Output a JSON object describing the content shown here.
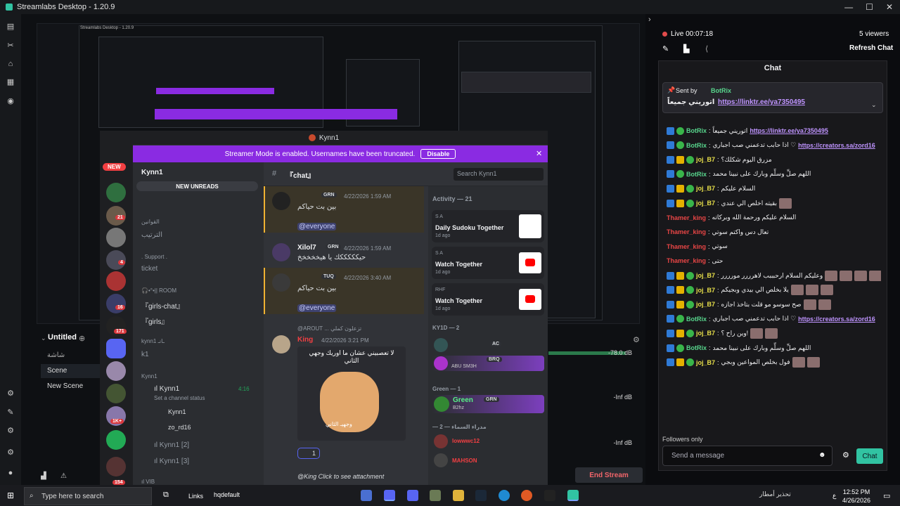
{
  "app": {
    "title": "Streamlabs Desktop - 1.20.9",
    "window_controls": [
      "—",
      "☐",
      "✕"
    ]
  },
  "nested_titles": {
    "outer": "Streamlabs Desktop - 1.20.9",
    "inner": "Kynn1"
  },
  "discord": {
    "window_title": "Kynn1",
    "banner_text": "Streamer Mode is enabled. Usernames have been truncated.",
    "banner_button": "Disable",
    "new_pill": "NEW",
    "server_name": "Kynn1",
    "channel_header": "『chat』",
    "search_placeholder": "Search Kynn1",
    "new_unreads": "NEW UNREADS",
    "server_badges": [
      "21",
      "4",
      "16",
      "171",
      "1K+",
      "154"
    ],
    "channels": {
      "cat_rules": "القوانين",
      "rules": "الترتيب",
      "support_cat": ". Support .",
      "ticket": "ticket",
      "room_cat": "🎧•°•|| ROOM",
      "girls_chat": "『girls-chat』",
      "girls": "『girls』",
      "kynn1_cat": "kynn1 ـانـ",
      "k1": "k1",
      "kynn1_voice_cat": "Kynn1",
      "voice1": "ıl Kynn1",
      "voice1_status": "Set a channel status",
      "voice1_time": "4:16",
      "voice_user1": "Kynn1",
      "voice_user1_tag": "GRN",
      "voice_user2": "zo_rd16",
      "voice2": "ıl Kynn1 [2]",
      "voice3": "ıl Kynn1 [3]",
      "vib": "ıl VIB"
    },
    "messages": [
      {
        "name": "",
        "tag": "GRN",
        "time": "4/22/2026 1:59 AM",
        "text": "بين بت حياكم",
        "mention": "@everyone"
      },
      {
        "name": "Xilol7",
        "tag": "GRN",
        "time": "4/22/2026 1:59 AM",
        "text": "حيكككككك يا هيخخخخخ"
      },
      {
        "name": "",
        "tag": "TUQ",
        "time": "4/22/2026 3:40 AM",
        "text": "بين بت حياكم",
        "mention": "@everyone"
      },
      {
        "name": "King",
        "tag": "",
        "time": "4/22/2026 3:21 PM",
        "reply": "@AROUT ... تزعلون كملي",
        "image_caption": "لا تعصبيني عشان ما اوريك وجهي الثاني",
        "image_text": "وجهيـ الثاني"
      },
      {
        "name": "",
        "time": "",
        "text": "@King Click to see attachment"
      }
    ],
    "reaction_count": "1",
    "activity": {
      "header": "Activity — 21",
      "cards": [
        {
          "who": "S A",
          "title": "Daily Sudoku Together",
          "ago": "1d ago"
        },
        {
          "who": "S A",
          "title": "Watch Together",
          "ago": "1d ago"
        },
        {
          "who": "RHF",
          "title": "Watch Together",
          "ago": "1d ago"
        }
      ]
    },
    "members": {
      "group1": "KY1D — 2",
      "m1_tag": "AC",
      "m2_name": "ABU SM3H",
      "m2_tag": "BRQ",
      "group2": "Green — 1",
      "m3_name": "Green",
      "m3_tag": "GRN",
      "m3_sub": "B2hz",
      "group3": "— مدراء السماء — 2",
      "m4_name": "lowwwc12",
      "m5_name": "MAHSON"
    }
  },
  "editor": {
    "scenes_title": "Untitled",
    "scene_collection_label": "شاشة",
    "scenes": [
      "Scene",
      "New Scene"
    ],
    "mixer": [
      "-78.0 dB",
      "-Inf dB",
      "-Inf dB"
    ],
    "end_stream": "End Stream"
  },
  "chat_panel": {
    "live_label": "Live 00:07:18",
    "viewers": "5 viewers",
    "refresh": "Refresh Chat",
    "title": "Chat",
    "pinned_by": "Sent by",
    "pinned_user": "BotRix",
    "pinned_text": "اتوريني جميعاً",
    "pinned_link": "https://linktr.ee/ya7350495",
    "lines": [
      {
        "user": "BotRix",
        "color": "g",
        "text": "اتوريني جميعاً",
        "link": "https://linktr.ee/ya7350495",
        "badges": 2
      },
      {
        "user": "BotRix",
        "color": "g",
        "text": "اذا حابب تدعمني صب اجباري ♡",
        "link": "https://creators.sa/zord16",
        "badges": 2
      },
      {
        "user": "joj_B7",
        "color": "y",
        "text": "مزرق اليوم شكلك؟",
        "badges": 3
      },
      {
        "user": "BotRix",
        "color": "g",
        "text": "اللهم صلِّ وسلِّم وبارك على نبينا محمد",
        "badges": 2
      },
      {
        "user": "joj_B7",
        "color": "y",
        "text": "السلام عليكم",
        "badges": 3
      },
      {
        "user": "joj_B7",
        "color": "y",
        "text": "بقيته اخلص الي عندي",
        "badges": 3,
        "emotes": 1
      },
      {
        "user": "Thamer_king",
        "color": "r",
        "text": "السلام عليكم ورحمة الله وبركاته",
        "badges": 0
      },
      {
        "user": "Thamer_king",
        "color": "r",
        "text": "تعال دس واكتم سوتي",
        "badges": 0
      },
      {
        "user": "Thamer_king",
        "color": "r",
        "text": "سوتي",
        "badges": 0
      },
      {
        "user": "Thamer_king",
        "color": "r",
        "text": "حتى",
        "badges": 0
      },
      {
        "user": "joj_B7",
        "color": "y",
        "text": "وعليكم السلام ارحبببب لاهرررر مورررر",
        "badges": 3,
        "emotes": 4
      },
      {
        "user": "joj_B7",
        "color": "y",
        "text": "يلا بخلص الي بيدي وبجيكم",
        "badges": 3,
        "emotes": 3
      },
      {
        "user": "joj_B7",
        "color": "y",
        "text": "صح سوسو مو قلت بتاخذ اجازه",
        "badges": 3,
        "emotes": 2
      },
      {
        "user": "BotRix",
        "color": "g",
        "text": "اذا حابب تدعمني صب اجباري ♡",
        "link": "https://creators.sa/zord16",
        "badges": 2
      },
      {
        "user": "joj_B7",
        "color": "y",
        "text": "وين راح ؟!",
        "badges": 3,
        "emotes": 2
      },
      {
        "user": "BotRix",
        "color": "g",
        "text": "اللهم صلِّ وسلِّم وبارك على نبينا محمد",
        "badges": 2
      },
      {
        "user": "joj_B7",
        "color": "y",
        "text": "فول بخلص المواعين وبجي",
        "badges": 3,
        "emotes": 2
      }
    ],
    "followers_only": "Followers only",
    "send_placeholder": "Send a message",
    "chat_button": "Chat"
  },
  "taskbar": {
    "search_placeholder": "Type here to search",
    "links": "Links",
    "hqdefault": "hqdefault",
    "weather": "تحذير أمطار",
    "lang": "ع",
    "time": "12:52 PM",
    "date": "4/26/2026"
  }
}
